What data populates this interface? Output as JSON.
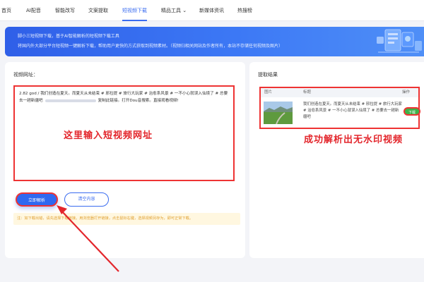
{
  "nav": {
    "items": [
      {
        "label": "首页"
      },
      {
        "label": "AI配音"
      },
      {
        "label": "智能改写"
      },
      {
        "label": "文案提取"
      },
      {
        "label": "短视频下载"
      },
      {
        "label": "精品工具 ⌄"
      },
      {
        "label": "新媒体资讯"
      },
      {
        "label": "热搜榜"
      }
    ],
    "active_index": 4
  },
  "banner": {
    "line1": "脚小三短视频下载，基于AI智能解析的短视频下载工具",
    "line2": "将国内外大部分平台短视频一键解析下载，帮助用户更快的方式获取到视频素材。（视频归相关网站及作者所有，本站不存储任何视频及图片）"
  },
  "input_panel": {
    "title": "视频网址：",
    "text_part1": "2.82 god / 我们创造在夏天。而夏天从未结束 # 邪拉提 # 旅行大玩家 # 治愈系风景 # 一不小心就误入仙境了 # 总要去一趟新疆吧",
    "text_part2": "复制此链接。打开Dou音搜索。直接观看视频!",
    "annotation": "这里输入短视频网址",
    "parse_button": "立即解析",
    "clear_button": "清空内容",
    "tip": "注：如下载出错，请先选择下载链接。用浏览器打开链接，点击鼠标右键，选择视频另存为，即可正常下载。"
  },
  "result_panel": {
    "title": "提取结果",
    "columns": [
      "图片",
      "标题",
      "操作"
    ],
    "row": {
      "title": "我们创造在夏天。而夏天从未结束 # 邪拉提 # 旅行大玩家 # 治愈系风景 # 一不小心就误入仙境了 # 总要去一趟新疆吧",
      "action": "下载"
    },
    "annotation": "成功解析出无水印视频"
  },
  "colors": {
    "accent": "#3a6cf0",
    "annotation_red": "#e3262c",
    "download_green": "#3fb24a"
  }
}
